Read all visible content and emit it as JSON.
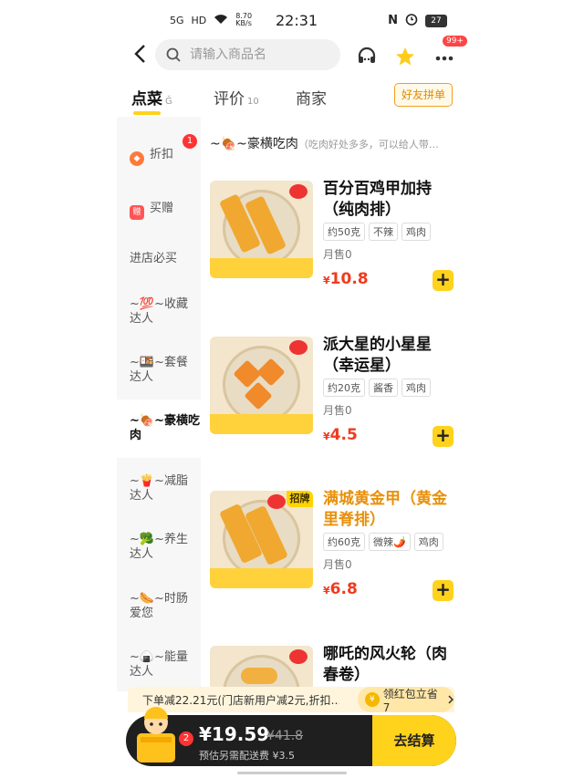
{
  "status": {
    "signal": "5G",
    "hd": "HD",
    "net_speed": "8.70 KB/s",
    "time": "22:31",
    "battery": "27"
  },
  "header": {
    "search_placeholder": "请输入商品名",
    "more_badge": "99+"
  },
  "tabs": [
    {
      "label": "点菜",
      "suffix": "Ǧ"
    },
    {
      "label": "评价",
      "suffix": "10"
    },
    {
      "label": "商家",
      "suffix": ""
    }
  ],
  "friend_group_label": "好友拼单",
  "sidebar": {
    "items": [
      {
        "label": "折扣",
        "badge": "1"
      },
      {
        "label": "买赠",
        "icon": "赠"
      },
      {
        "label": "进店必买"
      },
      {
        "label": "~💯~收藏达人"
      },
      {
        "label": "~🍱~套餐达人"
      },
      {
        "label": "~🍖~豪横吃肉"
      },
      {
        "label": "~🍟~减脂达人"
      },
      {
        "label": "~🥦~养生达人"
      },
      {
        "label": "~🌭~时肠爱您"
      },
      {
        "label": "~🍙~能量达人"
      }
    ]
  },
  "category": {
    "title": "~🍖~豪横吃肉",
    "desc": "（吃肉好处多多，可以给人带…"
  },
  "items": [
    {
      "name": "百分百鸡甲加持（纯肉排）",
      "tags": [
        "约50克",
        "不辣",
        "鸡肉"
      ],
      "sold": "月售0",
      "currency": "¥",
      "price": "10.8"
    },
    {
      "name": "派大星的小星星（幸运星）",
      "tags": [
        "约20克",
        "酱香",
        "鸡肉"
      ],
      "sold": "月售0",
      "currency": "¥",
      "price": "4.5"
    },
    {
      "name": "满城黄金甲（黄金里脊排）",
      "tags": [
        "约60克",
        "微辣🌶️",
        "鸡肉"
      ],
      "sold": "月售0",
      "currency": "¥",
      "price": "6.8",
      "badge": "招牌"
    },
    {
      "name": "哪吒的风火轮（肉春卷）",
      "tags": [],
      "sold": "",
      "currency": "",
      "price": ""
    }
  ],
  "promo": {
    "text": "下单减22.21元(门店新用户减2元,折扣…",
    "coupon": "领红包立省7"
  },
  "cart": {
    "count": "2",
    "price": "¥19.59",
    "original": "¥41.8",
    "fee": "预估另需配送费 ¥3.5",
    "checkout": "去结算"
  }
}
